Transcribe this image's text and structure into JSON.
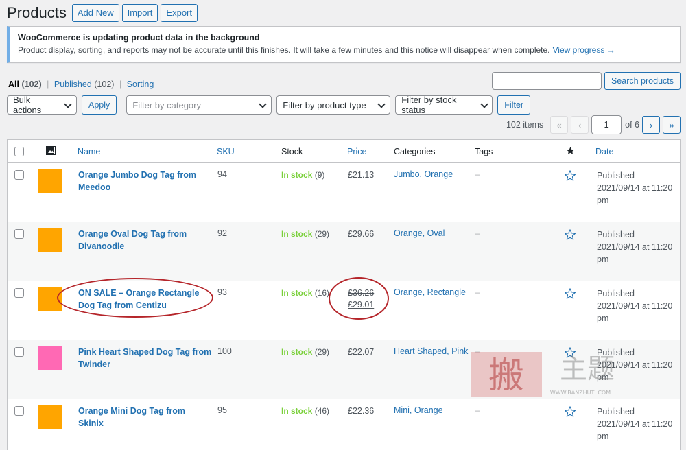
{
  "header": {
    "title": "Products",
    "add_new_label": "Add New",
    "import_label": "Import",
    "export_label": "Export"
  },
  "notice": {
    "title": "WooCommerce is updating product data in the background",
    "text": "Product display, sorting, and reports may not be accurate until this finishes. It will take a few minutes and this notice will disappear when complete.",
    "link": "View progress →"
  },
  "views": {
    "all_label": "All",
    "all_count": "(102)",
    "published_label": "Published",
    "published_count": "(102)",
    "sorting_label": "Sorting",
    "separator": "|"
  },
  "search": {
    "input_value": "",
    "button_label": "Search products"
  },
  "filters": {
    "bulk_actions": "Bulk actions",
    "apply_label": "Apply",
    "category_placeholder": "Filter by category",
    "product_type": "Filter by product type",
    "stock_status": "Filter by stock status",
    "filter_label": "Filter"
  },
  "pagination": {
    "items": "102 items",
    "first": "«",
    "prev": "‹",
    "current_page": "1",
    "of_pages": "of 6",
    "next": "›",
    "last": "»"
  },
  "columns": {
    "thumb_icon": "image-icon",
    "name": "Name",
    "sku": "SKU",
    "stock": "Stock",
    "price": "Price",
    "categories": "Categories",
    "tags": "Tags",
    "featured_icon": "star-filled-icon",
    "date": "Date"
  },
  "rows": [
    {
      "thumb_color": "#ffa500",
      "name_line1": "Orange Jumbo Dog Tag from",
      "name_line2": "Meedoo",
      "sku": "94",
      "stock_status": "In stock",
      "stock_count": "(9)",
      "price": "£21.13",
      "categories": "Jumbo, Orange",
      "tags": "–",
      "date_status": "Published",
      "date_value": "2021/09/14 at 11:20",
      "date_suffix": "pm"
    },
    {
      "thumb_color": "#ffa500",
      "name_line1": "Orange Oval Dog Tag from",
      "name_line2": "Divanoodle",
      "sku": "92",
      "stock_status": "In stock",
      "stock_count": "(29)",
      "price": "£29.66",
      "categories": "Orange, Oval",
      "tags": "–",
      "date_status": "Published",
      "date_value": "2021/09/14 at 11:20",
      "date_suffix": "pm"
    },
    {
      "thumb_color": "#ffa500",
      "name_line1": "ON SALE – Orange Rectangle",
      "name_line2": "Dog Tag from Centizu",
      "sku": "93",
      "stock_status": "In stock",
      "stock_count": "(16)",
      "price_regular": "£36.26",
      "price_sale": "£29.01",
      "categories": "Orange, Rectangle",
      "tags": "–",
      "date_status": "Published",
      "date_value": "2021/09/14 at 11:20",
      "date_suffix": "pm"
    },
    {
      "thumb_color": "#ff69b4",
      "name_line1": "Pink Heart Shaped Dog Tag from",
      "name_line2": "Twinder",
      "sku": "100",
      "stock_status": "In stock",
      "stock_count": "(29)",
      "price": "£22.07",
      "categories": "Heart Shaped, Pink",
      "tags": "–",
      "date_status": "Published",
      "date_value": "2021/09/14 at 11:20",
      "date_suffix": "pm"
    },
    {
      "thumb_color": "#ffa500",
      "name_line1": "Orange Mini Dog Tag from",
      "name_line2": "Skinix",
      "sku": "95",
      "stock_status": "In stock",
      "stock_count": "(46)",
      "price": "£22.36",
      "categories": "Mini, Orange",
      "tags": "–",
      "date_status": "Published",
      "date_value": "2021/09/14 at 11:20",
      "date_suffix": "pm"
    }
  ],
  "watermark": {
    "text": "搬主题",
    "url": "WWW.BANZHUTI.COM"
  },
  "colors": {
    "accent": "#2271b1",
    "in_stock": "#7ad03a",
    "annotation": "#b5252a"
  }
}
